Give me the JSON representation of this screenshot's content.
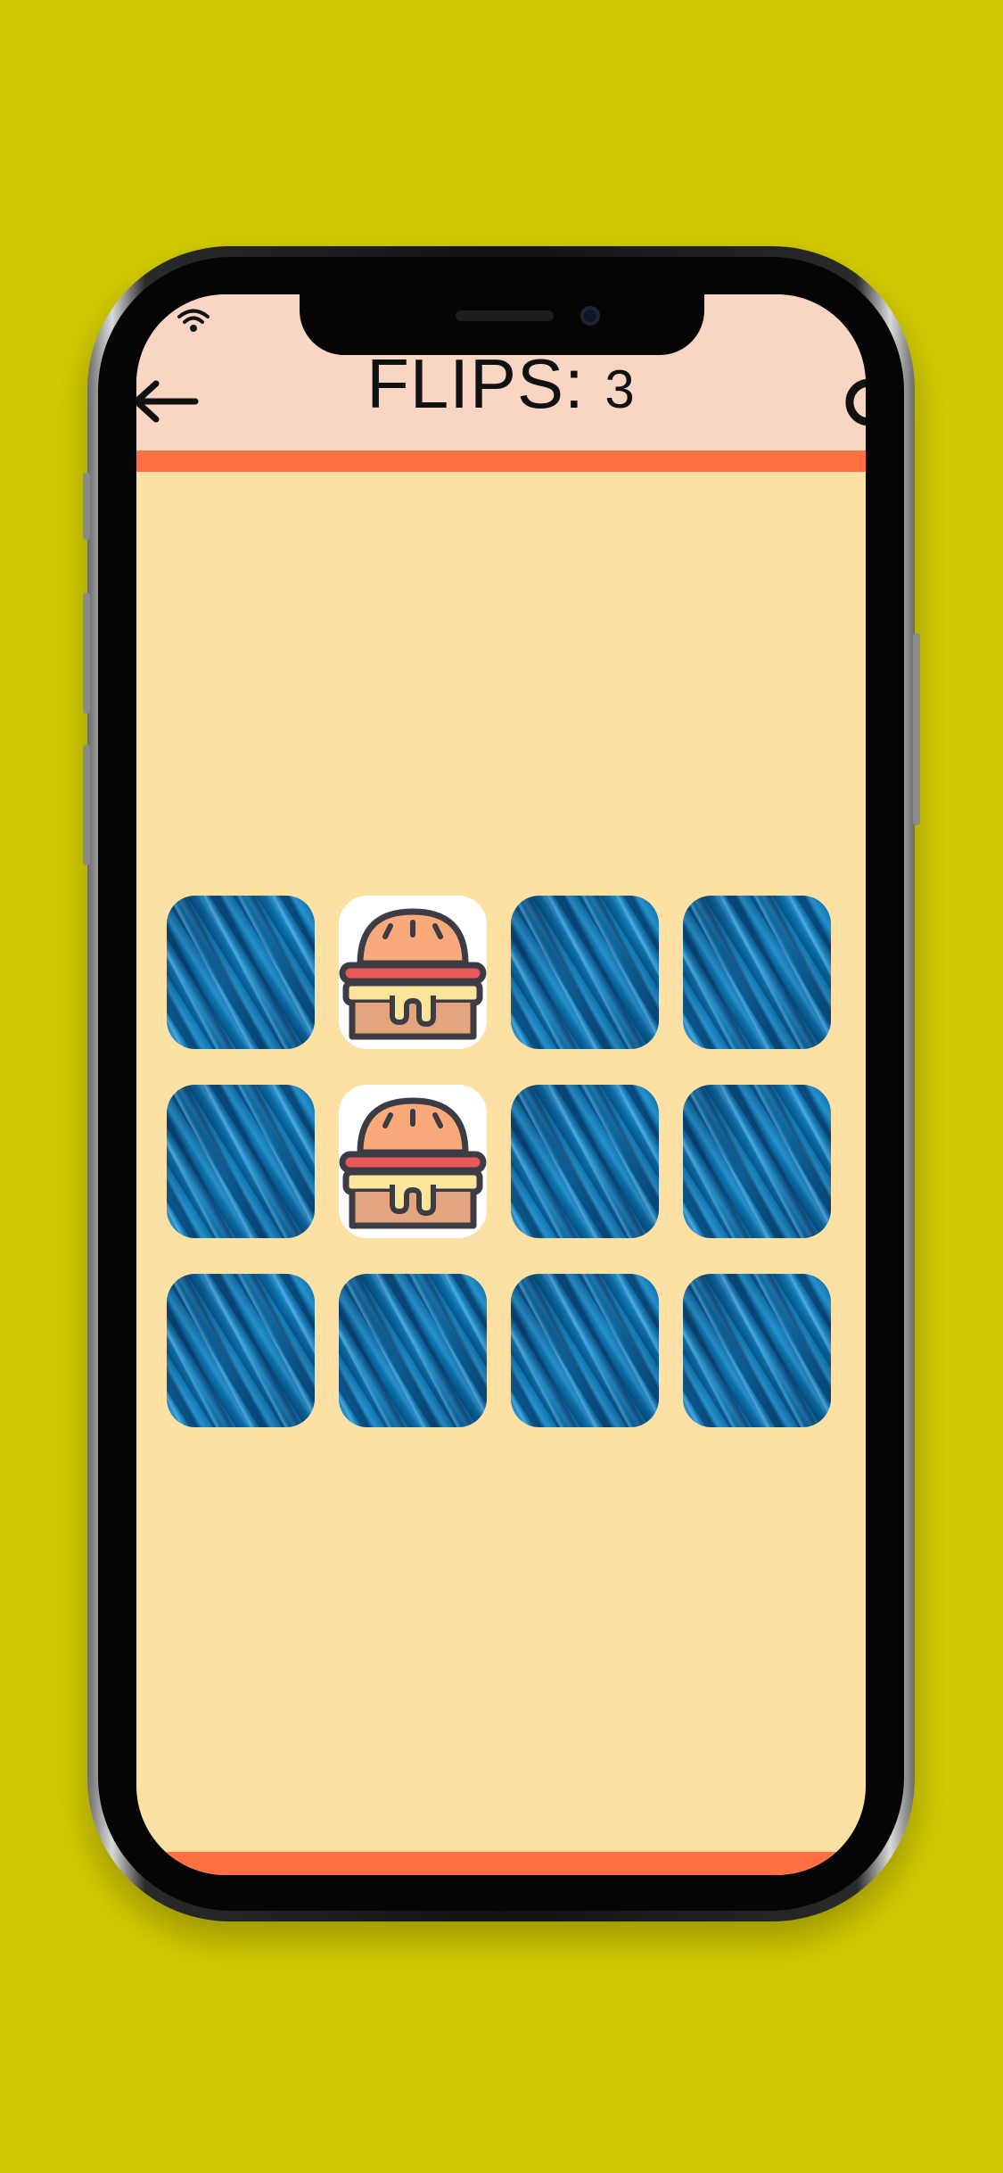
{
  "header": {
    "title": "FLIPS:",
    "flip_count": "3",
    "back_icon": "arrow-left-icon",
    "restart_icon": "restart-icon"
  },
  "status_bar": {
    "wifi_icon": "wifi-icon"
  },
  "board": {
    "rows": 3,
    "cols": 4,
    "cards": [
      {
        "state": "hidden"
      },
      {
        "state": "revealed",
        "icon": "burger-icon"
      },
      {
        "state": "hidden"
      },
      {
        "state": "hidden"
      },
      {
        "state": "hidden"
      },
      {
        "state": "revealed",
        "icon": "burger-icon"
      },
      {
        "state": "hidden"
      },
      {
        "state": "hidden"
      },
      {
        "state": "hidden"
      },
      {
        "state": "hidden"
      },
      {
        "state": "hidden"
      },
      {
        "state": "hidden"
      }
    ]
  },
  "colors": {
    "background": "#d1c900",
    "screen": "#fde0a3",
    "header": "#f9d6c4",
    "accent": "#ff7043",
    "card_back": "#0d78b5"
  }
}
